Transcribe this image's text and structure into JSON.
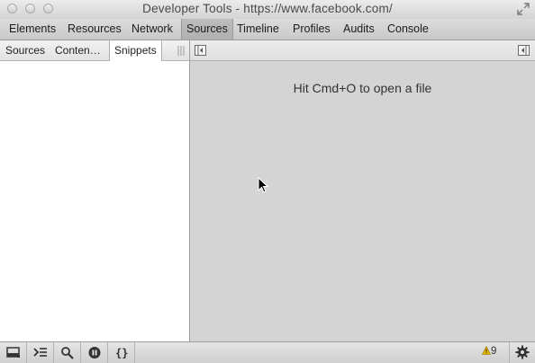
{
  "window": {
    "title": "Developer Tools - https://www.facebook.com/"
  },
  "tabs": [
    {
      "label": "Elements"
    },
    {
      "label": "Resources"
    },
    {
      "label": "Network"
    },
    {
      "label": "Sources",
      "active": true
    },
    {
      "label": "Timeline"
    },
    {
      "label": "Profiles"
    },
    {
      "label": "Audits"
    },
    {
      "label": "Console"
    }
  ],
  "navigator": {
    "tabs": [
      {
        "label": "Sources"
      },
      {
        "label": "Conten…"
      },
      {
        "label": "Snippets",
        "active": true
      }
    ]
  },
  "editor": {
    "hint": "Hit Cmd+O to open a file"
  },
  "status": {
    "warnings_count": "9",
    "icons": [
      "dock-icon",
      "console-drawer-icon",
      "search-icon",
      "pause-exceptions-icon",
      "pretty-print-icon",
      "warning-icon",
      "gear-icon"
    ]
  },
  "colors": {
    "editor_bg": "#d4d4d4",
    "toolbar_bg": "#c9c9c9",
    "warning": "#e8b400"
  }
}
